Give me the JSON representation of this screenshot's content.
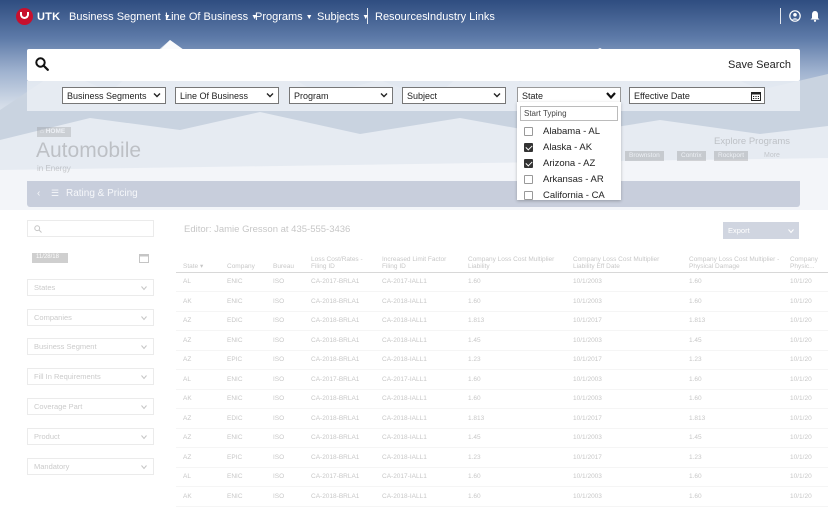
{
  "nav": {
    "brand": "UTK",
    "items": [
      {
        "label": "Business Segment",
        "dropdown": true
      },
      {
        "label": "Line Of Business",
        "dropdown": true
      },
      {
        "label": "Programs",
        "dropdown": true
      },
      {
        "label": "Subjects",
        "dropdown": true
      },
      {
        "label": "Resources",
        "dropdown": false
      },
      {
        "label": "Industry Links",
        "dropdown": false
      }
    ],
    "icons": [
      "user-icon",
      "bell-icon"
    ]
  },
  "search": {
    "save_label": "Save Search"
  },
  "filters": [
    {
      "label": "Business Segments"
    },
    {
      "label": "Line Of Business"
    },
    {
      "label": "Program"
    },
    {
      "label": "Subject"
    },
    {
      "label": "State"
    },
    {
      "label": "Effective Date"
    }
  ],
  "state_dropdown": {
    "placeholder": "Start Typing",
    "options": [
      {
        "label": "Alabama - AL",
        "checked": false
      },
      {
        "label": "Alaska - AK",
        "checked": true
      },
      {
        "label": "Arizona - AZ",
        "checked": true
      },
      {
        "label": "Arkansas - AR",
        "checked": false
      },
      {
        "label": "California - CA",
        "checked": false
      }
    ]
  },
  "page": {
    "home_label": "HOME",
    "title": "Automobile",
    "subtitle": "in Energy",
    "explore_label": "Explore Programs",
    "programs": [
      "Brownston",
      "Contrix",
      "Rockport"
    ],
    "more_label": "More",
    "section_title": "Rating & Pricing",
    "editor_text": "Editor: Jamie Gresson at 435-555-3436",
    "export_label": "Export"
  },
  "sidebar": {
    "date": "11/28/18",
    "fields": [
      "States",
      "Companies",
      "Business Segment",
      "Fill In Requirements",
      "Coverage Part",
      "Product",
      "Mandatory"
    ]
  },
  "table": {
    "columns": [
      "State",
      "Company",
      "Bureau",
      "Loss Cost/Rates - Filing ID",
      "Increased Limit Factor Filing ID",
      "Company Loss Cost Multiplier Liability",
      "Company Loss Cost Multiplier Liability Eff Date",
      "Company Loss Cost Multiplier - Physical Damage",
      "Company Physic..."
    ],
    "rows": [
      [
        "AL",
        "ENIC",
        "ISO",
        "CA-2017-BRLA1",
        "CA-2017-IALL1",
        "1.60",
        "10/1/2003",
        "1.60",
        "10/1/20"
      ],
      [
        "AK",
        "ENIC",
        "ISO",
        "CA-2018-BRLA1",
        "CA-2018-IALL1",
        "1.60",
        "10/1/2003",
        "1.60",
        "10/1/20"
      ],
      [
        "AZ",
        "EDIC",
        "ISO",
        "CA-2018-BRLA1",
        "CA-2018-IALL1",
        "1.813",
        "10/1/2017",
        "1.813",
        "10/1/20"
      ],
      [
        "AZ",
        "ENIC",
        "ISO",
        "CA-2018-BRLA1",
        "CA-2018-IALL1",
        "1.45",
        "10/1/2003",
        "1.45",
        "10/1/20"
      ],
      [
        "AZ",
        "EPIC",
        "ISO",
        "CA-2018-BRLA1",
        "CA-2018-IALL1",
        "1.23",
        "10/1/2017",
        "1.23",
        "10/1/20"
      ],
      [
        "AL",
        "ENIC",
        "ISO",
        "CA-2017-BRLA1",
        "CA-2017-IALL1",
        "1.60",
        "10/1/2003",
        "1.60",
        "10/1/20"
      ],
      [
        "AK",
        "ENIC",
        "ISO",
        "CA-2018-BRLA1",
        "CA-2018-IALL1",
        "1.60",
        "10/1/2003",
        "1.60",
        "10/1/20"
      ],
      [
        "AZ",
        "EDIC",
        "ISO",
        "CA-2018-BRLA1",
        "CA-2018-IALL1",
        "1.813",
        "10/1/2017",
        "1.813",
        "10/1/20"
      ],
      [
        "AZ",
        "ENIC",
        "ISO",
        "CA-2018-BRLA1",
        "CA-2018-IALL1",
        "1.45",
        "10/1/2003",
        "1.45",
        "10/1/20"
      ],
      [
        "AZ",
        "EPIC",
        "ISO",
        "CA-2018-BRLA1",
        "CA-2018-IALL1",
        "1.23",
        "10/1/2017",
        "1.23",
        "10/1/20"
      ],
      [
        "AL",
        "ENIC",
        "ISO",
        "CA-2017-BRLA1",
        "CA-2017-IALL1",
        "1.60",
        "10/1/2003",
        "1.60",
        "10/1/20"
      ],
      [
        "AK",
        "ENIC",
        "ISO",
        "CA-2018-BRLA1",
        "CA-2018-IALL1",
        "1.60",
        "10/1/2003",
        "1.60",
        "10/1/20"
      ]
    ]
  },
  "colors": {
    "brand": "#c8102e",
    "accent": "#5b6c94",
    "sky": "#2f4d80"
  }
}
